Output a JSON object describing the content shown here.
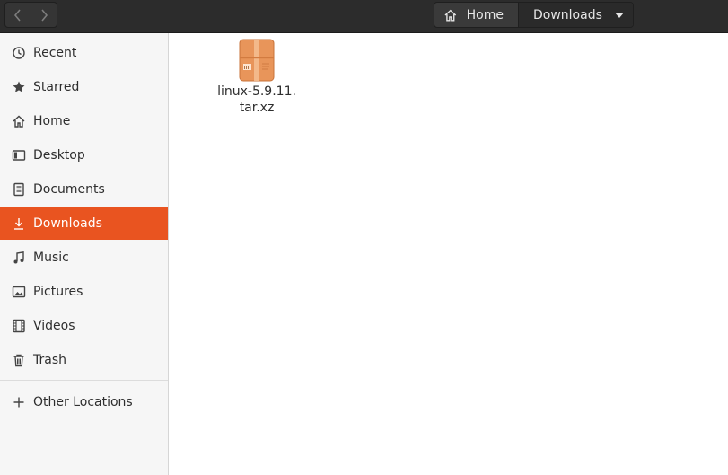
{
  "navigation": {
    "back_icon": "chevron-left-icon",
    "forward_icon": "chevron-right-icon"
  },
  "pathbar": {
    "home_label": "Home",
    "current_label": "Downloads"
  },
  "sidebar": {
    "items": [
      {
        "label": "Recent",
        "icon": "clock-icon"
      },
      {
        "label": "Starred",
        "icon": "star-icon"
      },
      {
        "label": "Home",
        "icon": "home-icon"
      },
      {
        "label": "Desktop",
        "icon": "desktop-icon"
      },
      {
        "label": "Documents",
        "icon": "document-icon"
      },
      {
        "label": "Downloads",
        "icon": "download-icon",
        "active": true
      },
      {
        "label": "Music",
        "icon": "music-note-icon"
      },
      {
        "label": "Pictures",
        "icon": "picture-icon"
      },
      {
        "label": "Videos",
        "icon": "film-icon"
      },
      {
        "label": "Trash",
        "icon": "trash-icon"
      }
    ],
    "other_locations": {
      "label": "Other Locations",
      "icon": "plus-icon"
    }
  },
  "files": [
    {
      "name": "linux-5.9.11.\ntar.xz",
      "icon": "archive-package-icon"
    }
  ],
  "colors": {
    "accent": "#e95420",
    "headerbar": "#2c2c2c",
    "sidebar_bg": "#f6f6f6"
  }
}
